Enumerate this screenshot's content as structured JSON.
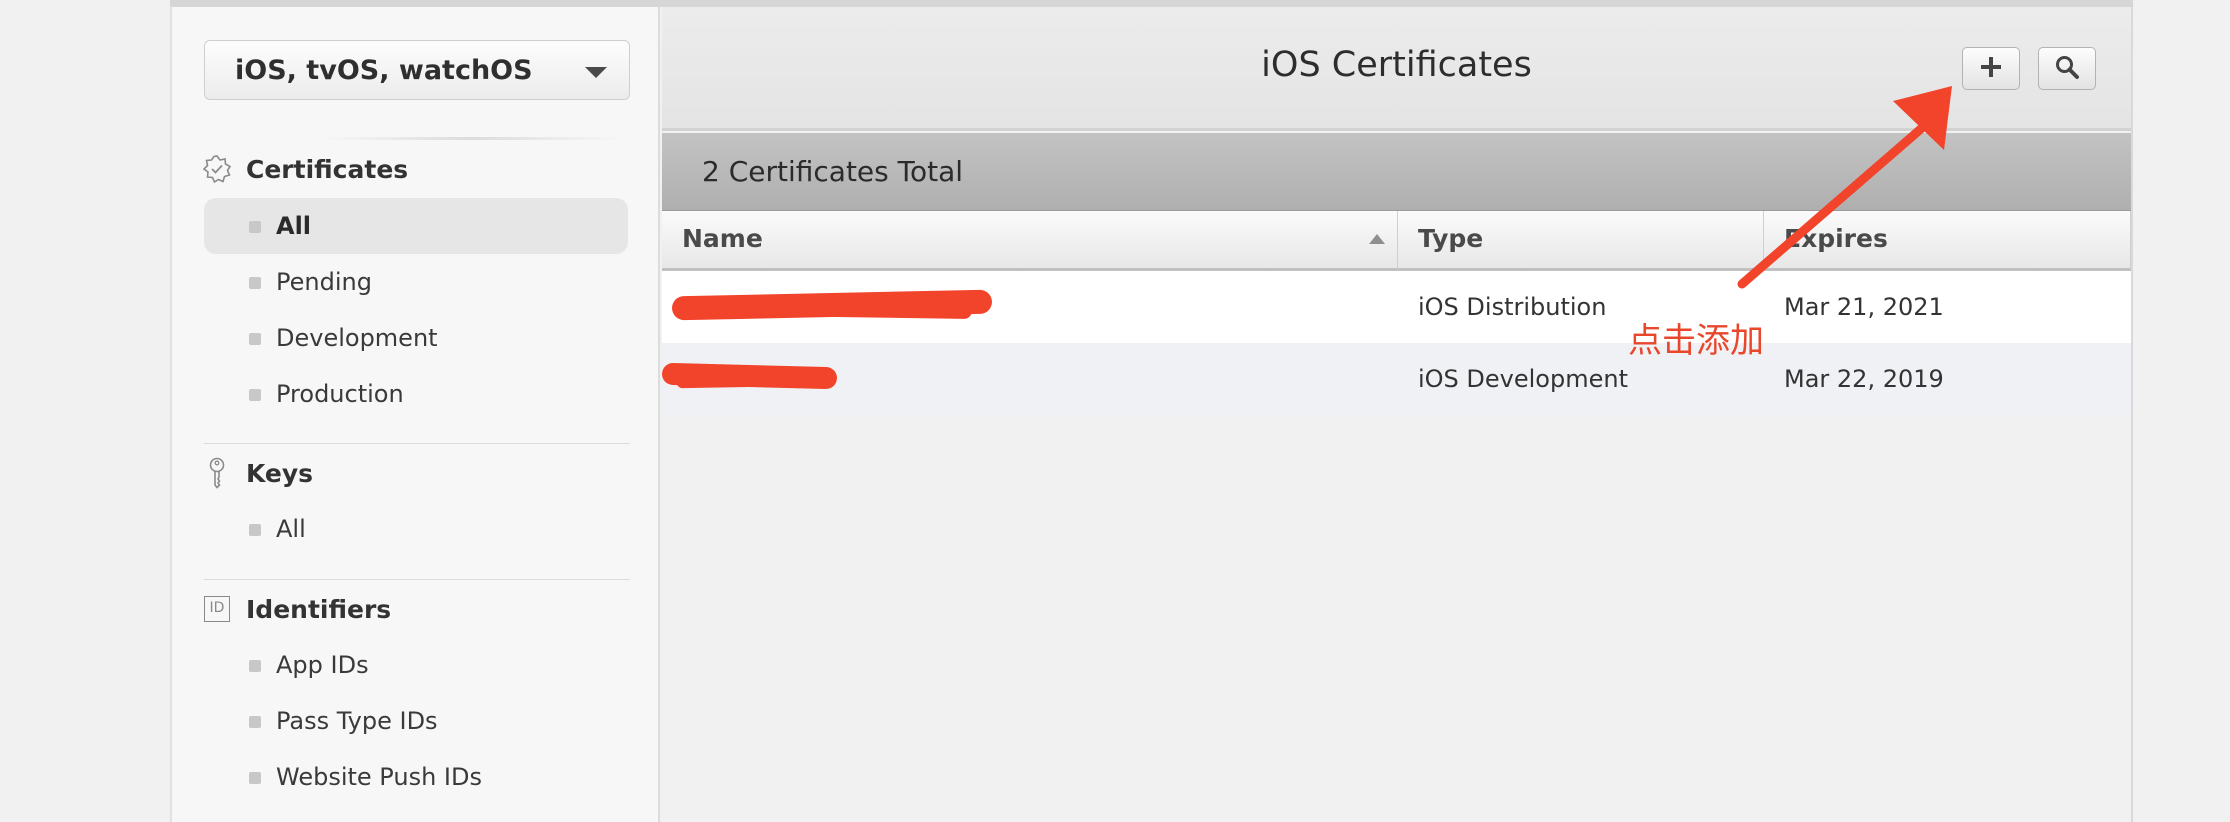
{
  "sidebar": {
    "platform_select": "iOS, tvOS, watchOS",
    "sections": {
      "certificates": {
        "title": "Certificates",
        "items": [
          "All",
          "Pending",
          "Development",
          "Production"
        ],
        "active": "All"
      },
      "keys": {
        "title": "Keys",
        "items": [
          "All"
        ]
      },
      "identifiers": {
        "title": "Identifiers",
        "icon_text": "ID",
        "items": [
          "App IDs",
          "Pass Type IDs",
          "Website Push IDs"
        ]
      }
    }
  },
  "main": {
    "title": "iOS Certificates",
    "toolbar": {
      "add_icon": "plus-icon",
      "search_icon": "search-icon"
    },
    "count_label": "2 Certificates Total",
    "table": {
      "columns": [
        "Name",
        "Type",
        "Expires"
      ],
      "rows": [
        {
          "name": "",
          "type": "iOS Distribution",
          "expires": "Mar 21, 2021"
        },
        {
          "name": "",
          "type": "iOS Development",
          "expires": "Mar 22, 2019"
        }
      ]
    }
  },
  "annotation": {
    "text": "点击添加",
    "color": "#e8472c"
  },
  "colors": {
    "redaction": "#f2432b",
    "active_item_bg": "#e6e6e6",
    "alt_row_bg": "#eff1f5"
  }
}
